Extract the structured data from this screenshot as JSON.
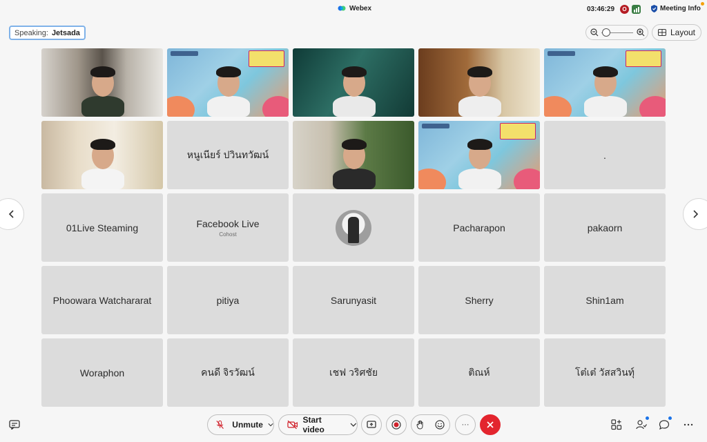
{
  "window": {
    "app_title": "Webex",
    "clock": "03:46:29",
    "recording_badge": "O",
    "meeting_info_label": "Meeting Info"
  },
  "speaking": {
    "label": "Speaking:",
    "name": "Jetsada"
  },
  "toolbar_top": {
    "layout_label": "Layout",
    "zoom_icon_out": "zoom-out-icon",
    "zoom_icon_in": "zoom-in-icon"
  },
  "tiles": [
    {
      "type": "video",
      "scene": "room"
    },
    {
      "type": "video",
      "scene": "banner"
    },
    {
      "type": "video",
      "scene": "green"
    },
    {
      "type": "video",
      "scene": "warm"
    },
    {
      "type": "video",
      "scene": "banner"
    },
    {
      "type": "video",
      "scene": "curtain"
    },
    {
      "type": "name",
      "name": "หนูเนียร์ ปวินทวัฒน์"
    },
    {
      "type": "video",
      "scene": "forest"
    },
    {
      "type": "video",
      "scene": "banner"
    },
    {
      "type": "name",
      "name": "."
    },
    {
      "type": "name",
      "name": "01Live Steaming"
    },
    {
      "type": "name",
      "name": "Facebook Live",
      "role": "Cohost"
    },
    {
      "type": "avatar"
    },
    {
      "type": "name",
      "name": "Pacharapon"
    },
    {
      "type": "name",
      "name": "pakaorn"
    },
    {
      "type": "name",
      "name": "Phoowara Watchararat"
    },
    {
      "type": "name",
      "name": "pitiya"
    },
    {
      "type": "name",
      "name": "Sarunyasit"
    },
    {
      "type": "name",
      "name": "Sherry"
    },
    {
      "type": "name",
      "name": "Shin1am"
    },
    {
      "type": "name",
      "name": "Woraphon"
    },
    {
      "type": "name",
      "name": "คนดี จิรวัฒน์"
    },
    {
      "type": "name",
      "name": "เชฟ วริศชัย"
    },
    {
      "type": "name",
      "name": "ติณห์"
    },
    {
      "type": "name",
      "name": "โต๋เต๋ วัสสวินทุ์"
    }
  ],
  "controls": {
    "unmute_label": "Unmute",
    "start_video_label": "Start video",
    "more_label": "···"
  },
  "colors": {
    "end_call": "#e3252e",
    "accent_blue": "#1a73e8",
    "recording": "#b51c24"
  }
}
